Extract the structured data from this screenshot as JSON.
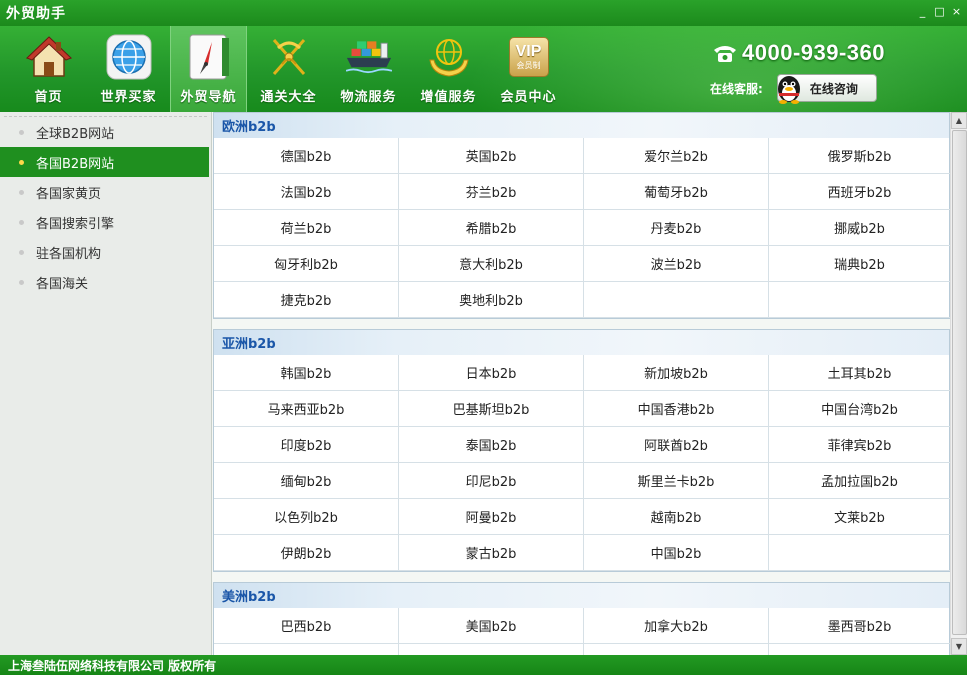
{
  "window": {
    "title": "外贸助手",
    "minimize": "_",
    "maximize": "□",
    "close": "×"
  },
  "nav": [
    {
      "label": "首页",
      "icon": "house-icon"
    },
    {
      "label": "世界买家",
      "icon": "globe-icon"
    },
    {
      "label": "外贸导航",
      "icon": "compass-icon",
      "active": true
    },
    {
      "label": "通关大全",
      "icon": "caduceus-icon"
    },
    {
      "label": "物流服务",
      "icon": "cargo-ship-icon"
    },
    {
      "label": "增值服务",
      "icon": "hands-globe-icon"
    },
    {
      "label": "会员中心",
      "icon": "vip-icon",
      "badge": "VIP",
      "badge_sub": "会员制"
    }
  ],
  "contact": {
    "hotline": "4000-939-360",
    "service_label": "在线客服:",
    "consult_button": "在线咨询"
  },
  "sidebar": {
    "items": [
      {
        "label": "全球B2B网站"
      },
      {
        "label": "各国B2B网站",
        "active": true
      },
      {
        "label": "各国家黄页"
      },
      {
        "label": "各国搜索引擎"
      },
      {
        "label": "驻各国机构"
      },
      {
        "label": "各国海关"
      }
    ]
  },
  "regions": [
    {
      "title": "欧洲b2b",
      "links": [
        "德国b2b",
        "英国b2b",
        "爱尔兰b2b",
        "俄罗斯b2b",
        "法国b2b",
        "芬兰b2b",
        "葡萄牙b2b",
        "西班牙b2b",
        "荷兰b2b",
        "希腊b2b",
        "丹麦b2b",
        "挪威b2b",
        "匈牙利b2b",
        "意大利b2b",
        "波兰b2b",
        "瑞典b2b",
        "捷克b2b",
        "奥地利b2b"
      ]
    },
    {
      "title": "亚洲b2b",
      "links": [
        "韩国b2b",
        "日本b2b",
        "新加坡b2b",
        "土耳其b2b",
        "马来西亚b2b",
        "巴基斯坦b2b",
        "中国香港b2b",
        "中国台湾b2b",
        "印度b2b",
        "泰国b2b",
        "阿联酋b2b",
        "菲律宾b2b",
        "缅甸b2b",
        "印尼b2b",
        "斯里兰卡b2b",
        "孟加拉国b2b",
        "以色列b2b",
        "阿曼b2b",
        "越南b2b",
        "文莱b2b",
        "伊朗b2b",
        "蒙古b2b",
        "中国b2b"
      ]
    },
    {
      "title": "美洲b2b",
      "links": [
        "巴西b2b",
        "美国b2b",
        "加拿大b2b",
        "墨西哥b2b"
      ]
    }
  ],
  "footer": {
    "copyright": "上海叁陆伍网络科技有限公司 版权所有"
  },
  "colors": {
    "brand_green": "#1f8f1f",
    "region_title": "#1a56a8",
    "active_dot": "#ffd84a"
  }
}
